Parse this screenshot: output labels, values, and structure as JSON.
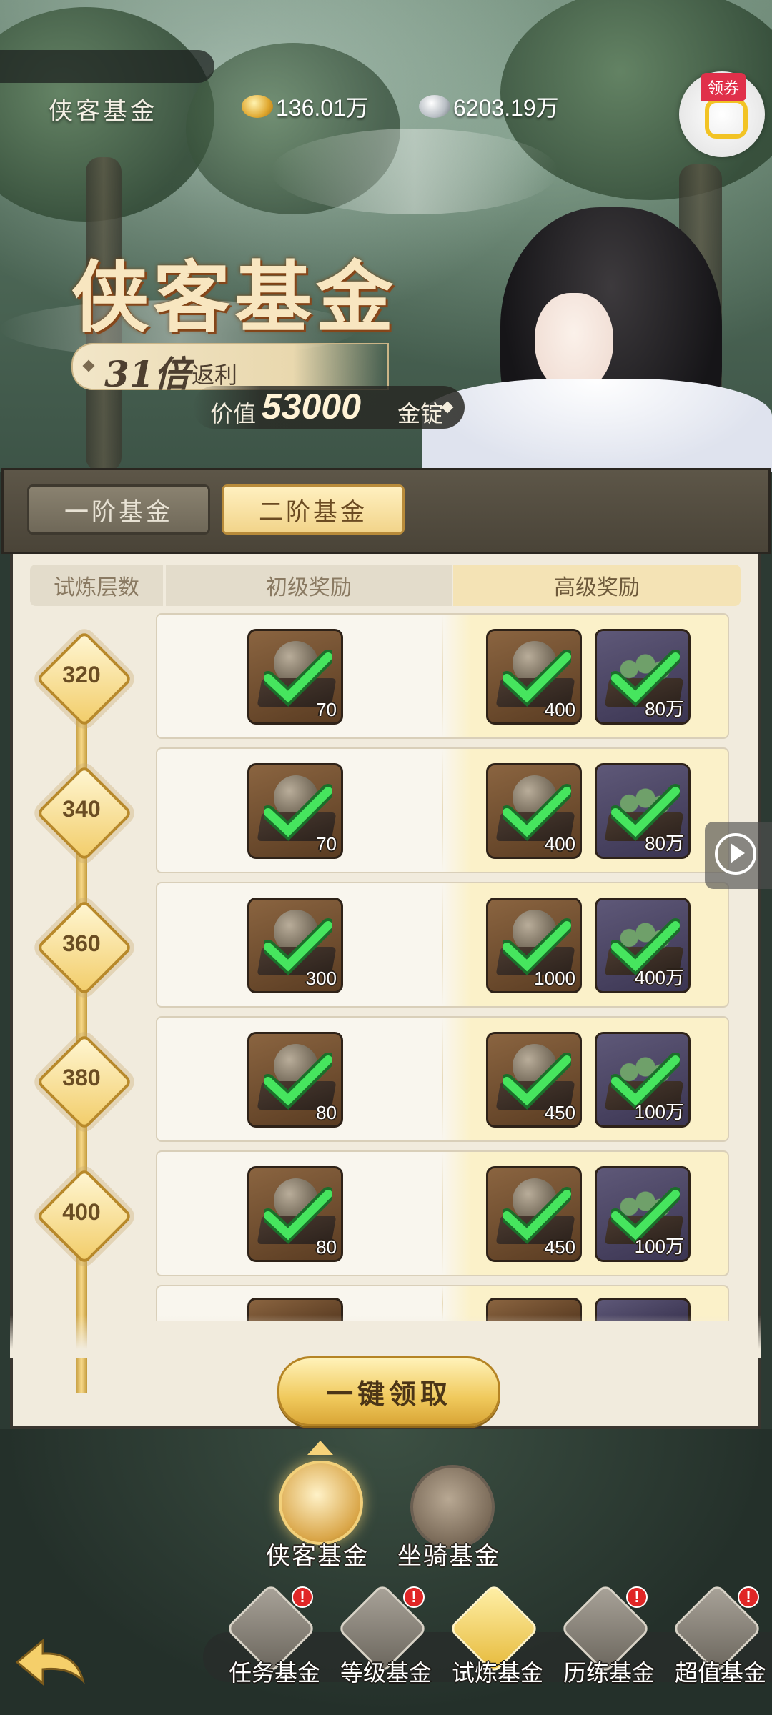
{
  "header": {
    "title": "侠客基金",
    "gold_amount": "136.01万",
    "silver_amount": "6203.19万",
    "coupon_label": "领券"
  },
  "banner": {
    "title": "侠客基金",
    "multiplier_number": "31倍",
    "multiplier_suffix": "返利",
    "value_prefix": "价值",
    "value_amount": "53000",
    "value_unit": "金锭"
  },
  "tabs": [
    {
      "label": "一阶基金",
      "active": false
    },
    {
      "label": "二阶基金",
      "active": true
    }
  ],
  "table": {
    "headers": {
      "level": "试炼层数",
      "basic": "初级奖励",
      "advanced": "高级奖励"
    },
    "rows": [
      {
        "level": "320",
        "basic_qty": "70",
        "adv_qty1": "400",
        "adv_qty2": "80万"
      },
      {
        "level": "340",
        "basic_qty": "70",
        "adv_qty1": "400",
        "adv_qty2": "80万"
      },
      {
        "level": "360",
        "basic_qty": "300",
        "adv_qty1": "1000",
        "adv_qty2": "400万"
      },
      {
        "level": "380",
        "basic_qty": "80",
        "adv_qty1": "450",
        "adv_qty2": "100万"
      },
      {
        "level": "400",
        "basic_qty": "80",
        "adv_qty1": "450",
        "adv_qty2": "100万"
      }
    ]
  },
  "claim_all_label": "一键领取",
  "fund_switch": [
    {
      "label": "侠客基金",
      "active": true
    },
    {
      "label": "坐骑基金",
      "active": false
    }
  ],
  "bottom_nav": [
    {
      "label": "任务基金",
      "alert": "!"
    },
    {
      "label": "等级基金",
      "alert": "!"
    },
    {
      "label": "试炼基金",
      "alert": ""
    },
    {
      "label": "历练基金",
      "alert": "!"
    },
    {
      "label": "超值基金",
      "alert": "!"
    }
  ],
  "colors": {
    "check_green": "#3fe05a",
    "gold_accent": "#f2cd6a",
    "panel_bg": "#f1ebdd"
  }
}
